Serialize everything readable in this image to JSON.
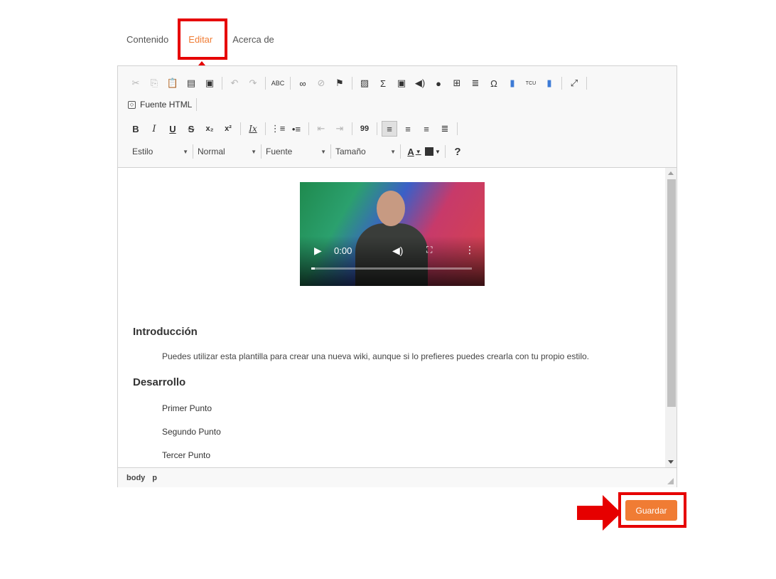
{
  "tabs": [
    {
      "label": "Contenido",
      "active": false
    },
    {
      "label": "Editar",
      "active": true
    },
    {
      "label": "Acerca de",
      "active": false
    }
  ],
  "toolbar": {
    "row1_icons": [
      "cut-icon",
      "copy-icon",
      "paste-icon",
      "paste-text-icon",
      "paste-word-icon",
      "undo-icon",
      "redo-icon",
      "spellcheck-icon",
      "link-icon",
      "unlink-icon",
      "anchor-icon",
      "image-icon",
      "formula-icon",
      "video-icon",
      "audio-icon",
      "flash-icon",
      "table-icon",
      "horizontal-rule-icon",
      "special-char-icon",
      "template-icon",
      "tcu-icon",
      "document-icon",
      "maximize-icon"
    ],
    "row1_glyphs": {
      "spellcheck": "ABC",
      "formula": "Σ",
      "special_char": "Ω",
      "tcu": "TCU"
    },
    "source_label": "Fuente HTML",
    "row3_glyphs": {
      "bold": "B",
      "italic": "I",
      "underline": "U",
      "strike": "S",
      "subscript": "x₂",
      "superscript": "x²",
      "remove_format": "Ix",
      "blockquote": "99"
    },
    "style_combo": "Estilo",
    "format_combo": "Normal",
    "font_combo": "Fuente",
    "size_combo": "Tamaño",
    "text_color": "A",
    "help": "?"
  },
  "video": {
    "time": "0:00",
    "progress_fraction": 0.02
  },
  "content": {
    "heading_intro": "Introducción",
    "paragraph_intro": "Puedes utilizar esta plantilla para crear una nueva wiki, aunque si lo prefieres puedes crearla con tu propio estilo.",
    "heading_dev": "Desarrollo",
    "list_items": [
      "Primer Punto",
      "Segundo Punto",
      "Tercer Punto"
    ]
  },
  "statusbar": {
    "path": [
      "body",
      "p"
    ]
  },
  "save_button": "Guardar",
  "colors": {
    "accent": "#f07c34",
    "highlight": "#e60000"
  }
}
